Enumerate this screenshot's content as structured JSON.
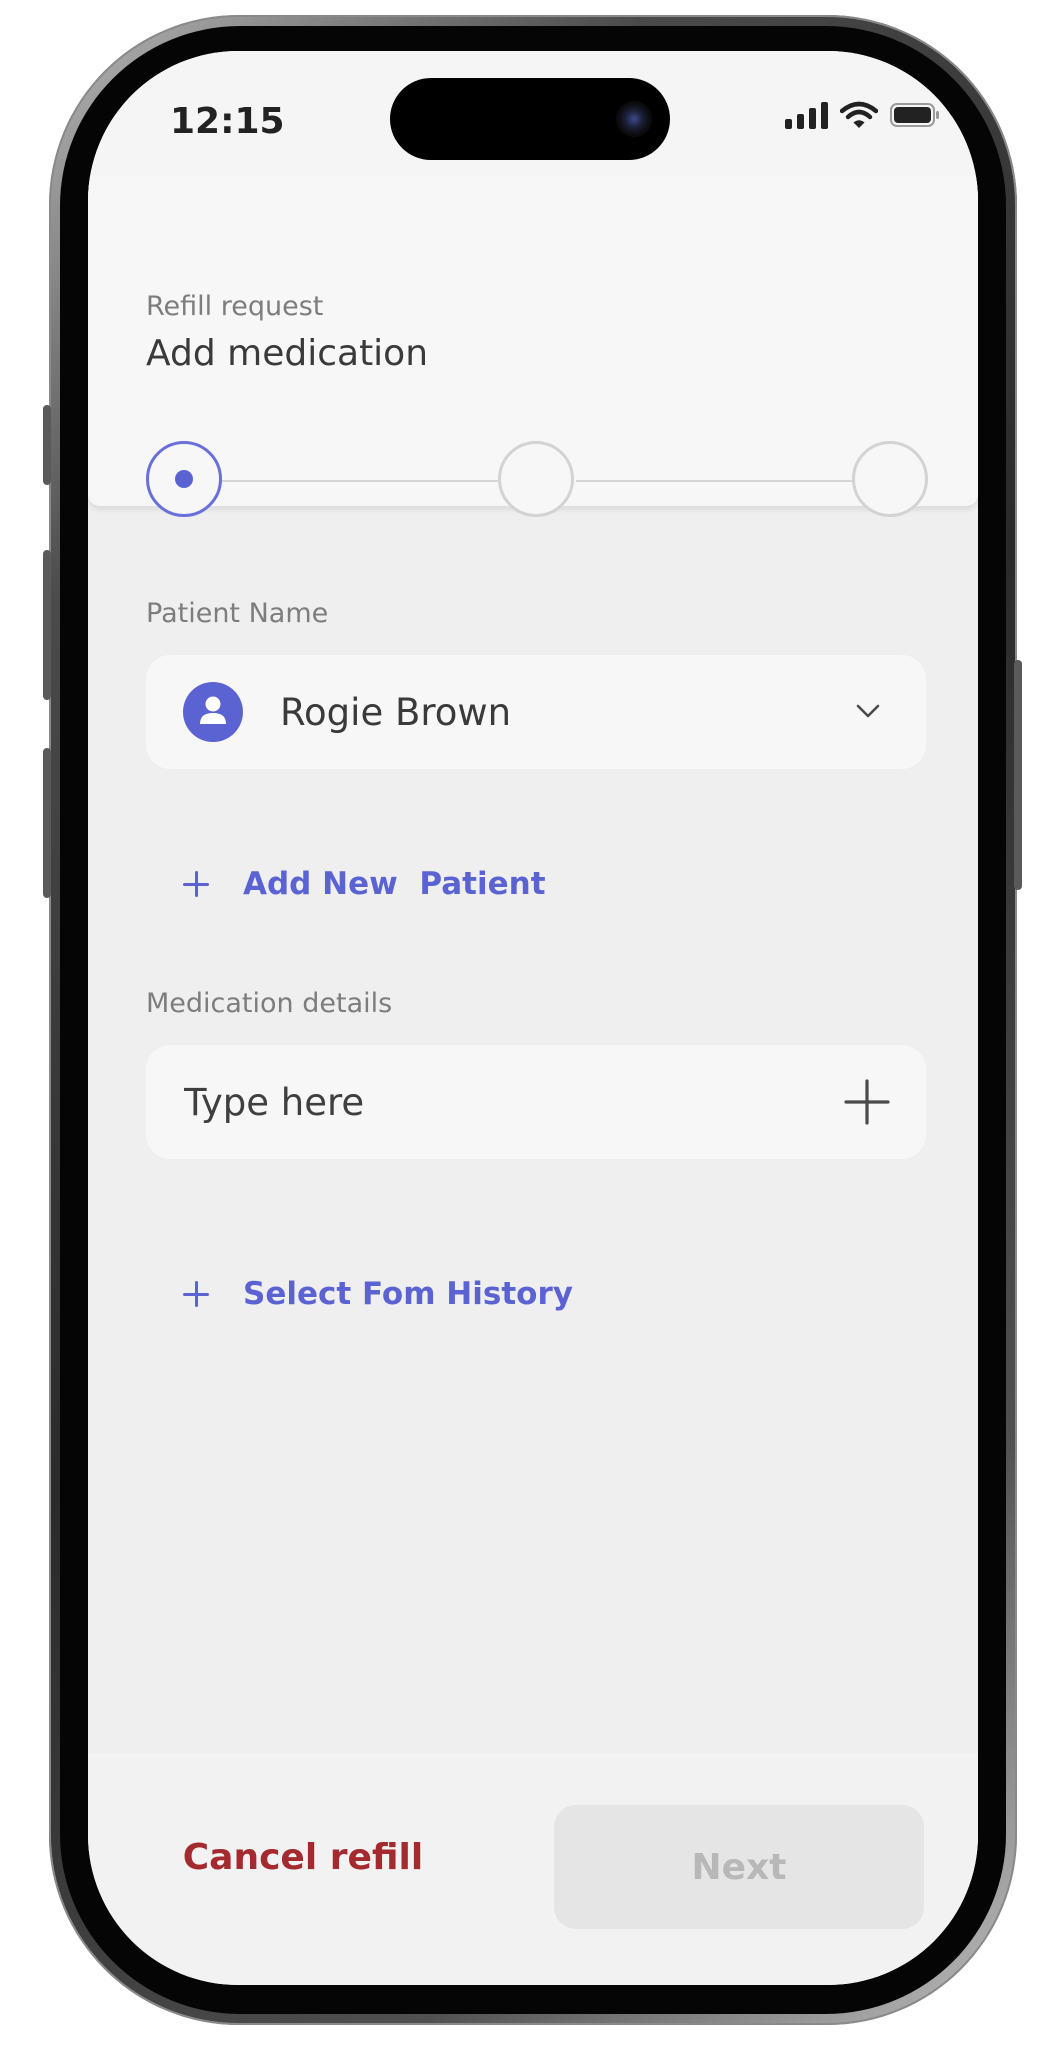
{
  "status_bar": {
    "time": "12:15",
    "icons": [
      "signal-icon",
      "wifi-icon",
      "battery-icon"
    ]
  },
  "header": {
    "subtitle": "Refill request",
    "title": "Add medication"
  },
  "stepper": {
    "total_steps": 3,
    "current_step": 1
  },
  "patient": {
    "label": "Patient Name",
    "selected_name": "Rogie Brown",
    "add_link": "Add New  Patient"
  },
  "medication": {
    "label": "Medication details",
    "placeholder": "Type here",
    "value": "",
    "history_link": "Select Fom History"
  },
  "footer": {
    "cancel_label": "Cancel refill",
    "next_label": "Next",
    "next_enabled": false
  },
  "colors": {
    "accent": "#5b63d3",
    "danger": "#a32a2e",
    "disabled_text": "#b8b8b8",
    "background": "#efefef"
  }
}
